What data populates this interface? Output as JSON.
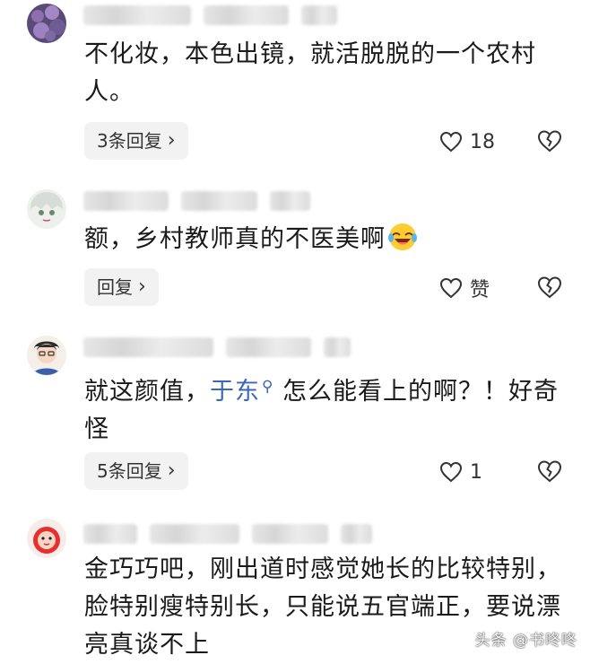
{
  "comments": [
    {
      "text": "不化妆，本色出镜，就活脱脱的一个农村人。",
      "reply_label": "3条回复",
      "likes": "18"
    },
    {
      "text_prefix": "额，乡村教师真的不医美啊",
      "emoji": "laughing-crying-emoji",
      "reply_label": "回复",
      "likes": "赞"
    },
    {
      "text_prefix": "就这颜值，",
      "mention": "于东",
      "text_suffix": "怎么能看上的啊？！好奇怪",
      "reply_label": "5条回复",
      "likes": "1"
    },
    {
      "text": "金巧巧吧，刚出道时感觉她长的比较特别，脸特别瘦特别长，只能说五官端正，要说漂亮真谈不上"
    }
  ],
  "icons": {
    "like": "heart-outline-icon",
    "dislike": "broken-heart-icon",
    "reply_chevron": "chevron-right-icon",
    "mention_search": "search-icon"
  },
  "watermark": "头条 @书咚咚",
  "colors": {
    "mention": "#3a67b8",
    "pill_bg": "#f2f2f2",
    "text": "#1a1a1a"
  }
}
